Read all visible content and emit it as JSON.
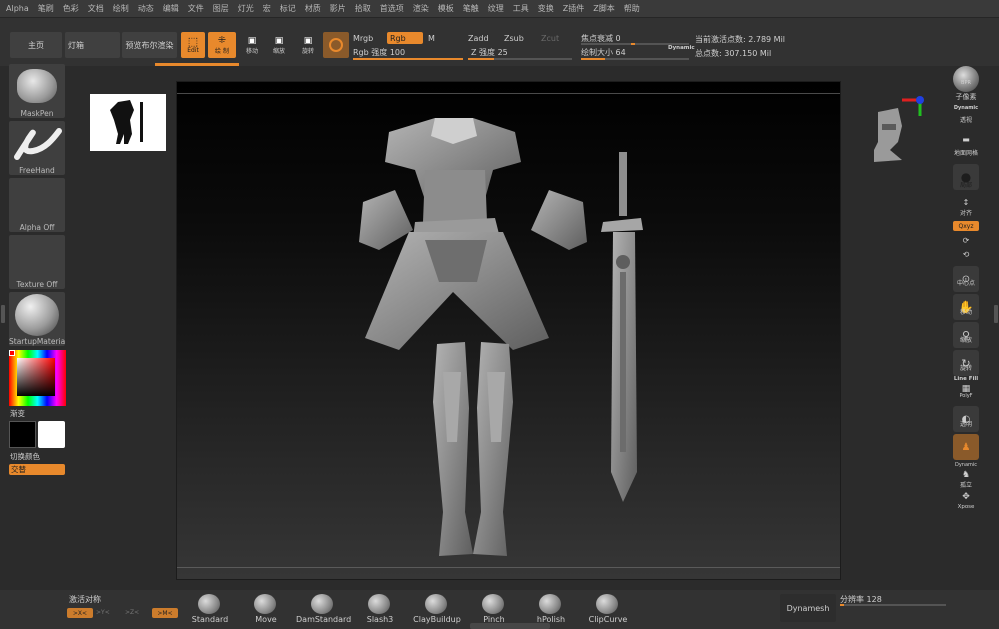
{
  "menu": [
    "Alpha",
    "笔刷",
    "色彩",
    "文档",
    "绘制",
    "动态",
    "编辑",
    "文件",
    "图层",
    "灯光",
    "宏",
    "标记",
    "材质",
    "影片",
    "拾取",
    "首选项",
    "渲染",
    "模板",
    "笔触",
    "纹理",
    "工具",
    "变换",
    "Z插件",
    "Z脚本",
    "帮助"
  ],
  "shelf": {
    "home": "主页",
    "lightbox": "灯箱",
    "bpr": "预览布尔渲染",
    "edit": "Edit",
    "draw": "绘 制",
    "move": "移动",
    "scale": "缩放",
    "rotate": "旋转",
    "mrgb": "Mrgb",
    "rgb": "Rgb",
    "m": "M",
    "rgb_intensity_label": "Rgb 强度",
    "rgb_intensity": "100",
    "zadd": "Zadd",
    "zsub": "Zsub",
    "zcut": "Zcut",
    "z_intensity_label": "Z 强度",
    "z_intensity": "25",
    "focal_label": "焦点衰减",
    "focal": "0",
    "draw_size_label": "绘制大小",
    "draw_size": "64",
    "dynamic": "Dynamic",
    "active_points": "当前激活点数: 2.789 Mil",
    "total_points": "总点数: 307.150 Mil"
  },
  "left": {
    "brush": "MaskPen",
    "stroke": "FreeHand",
    "alpha": "Alpha Off",
    "texture": "Texture Off",
    "material": "StartupMaterial",
    "gradient": "渐变",
    "switch_color": "切换颜色",
    "alternate": "交替"
  },
  "right": {
    "bpr": "BPR",
    "subpixel": "子像素",
    "dynamic_persp": "Dynamic",
    "persp": "透视",
    "floor": "地面网格",
    "local": "局部",
    "frame": "对齐",
    "xyz": "Qxyz",
    "center": "中心点",
    "move": "移动",
    "scale": "缩放",
    "rotate": "旋转",
    "linefill": "Line Fill",
    "polyf": "PolyF",
    "transp": "透明",
    "dyn": "Dynamic",
    "solo": "孤立",
    "xpose": "Xpose"
  },
  "bottom": {
    "symmetry": "激活对称",
    "sym_x": ">X<",
    "sym_y": ">Y<",
    "sym_z": ">Z<",
    "sym_m": ">M<",
    "brushes": [
      "Standard",
      "Move",
      "DamStandard",
      "Slash3",
      "ClayBuildup",
      "Pinch",
      "hPolish",
      "ClipCurve"
    ],
    "dynamesh": "Dynamesh",
    "resolution_label": "分辨率",
    "resolution": "128"
  },
  "colors": {
    "accent": "#e8892c",
    "panel": "#323232",
    "viewport_top": "#000000",
    "viewport_bottom": "#363636"
  }
}
